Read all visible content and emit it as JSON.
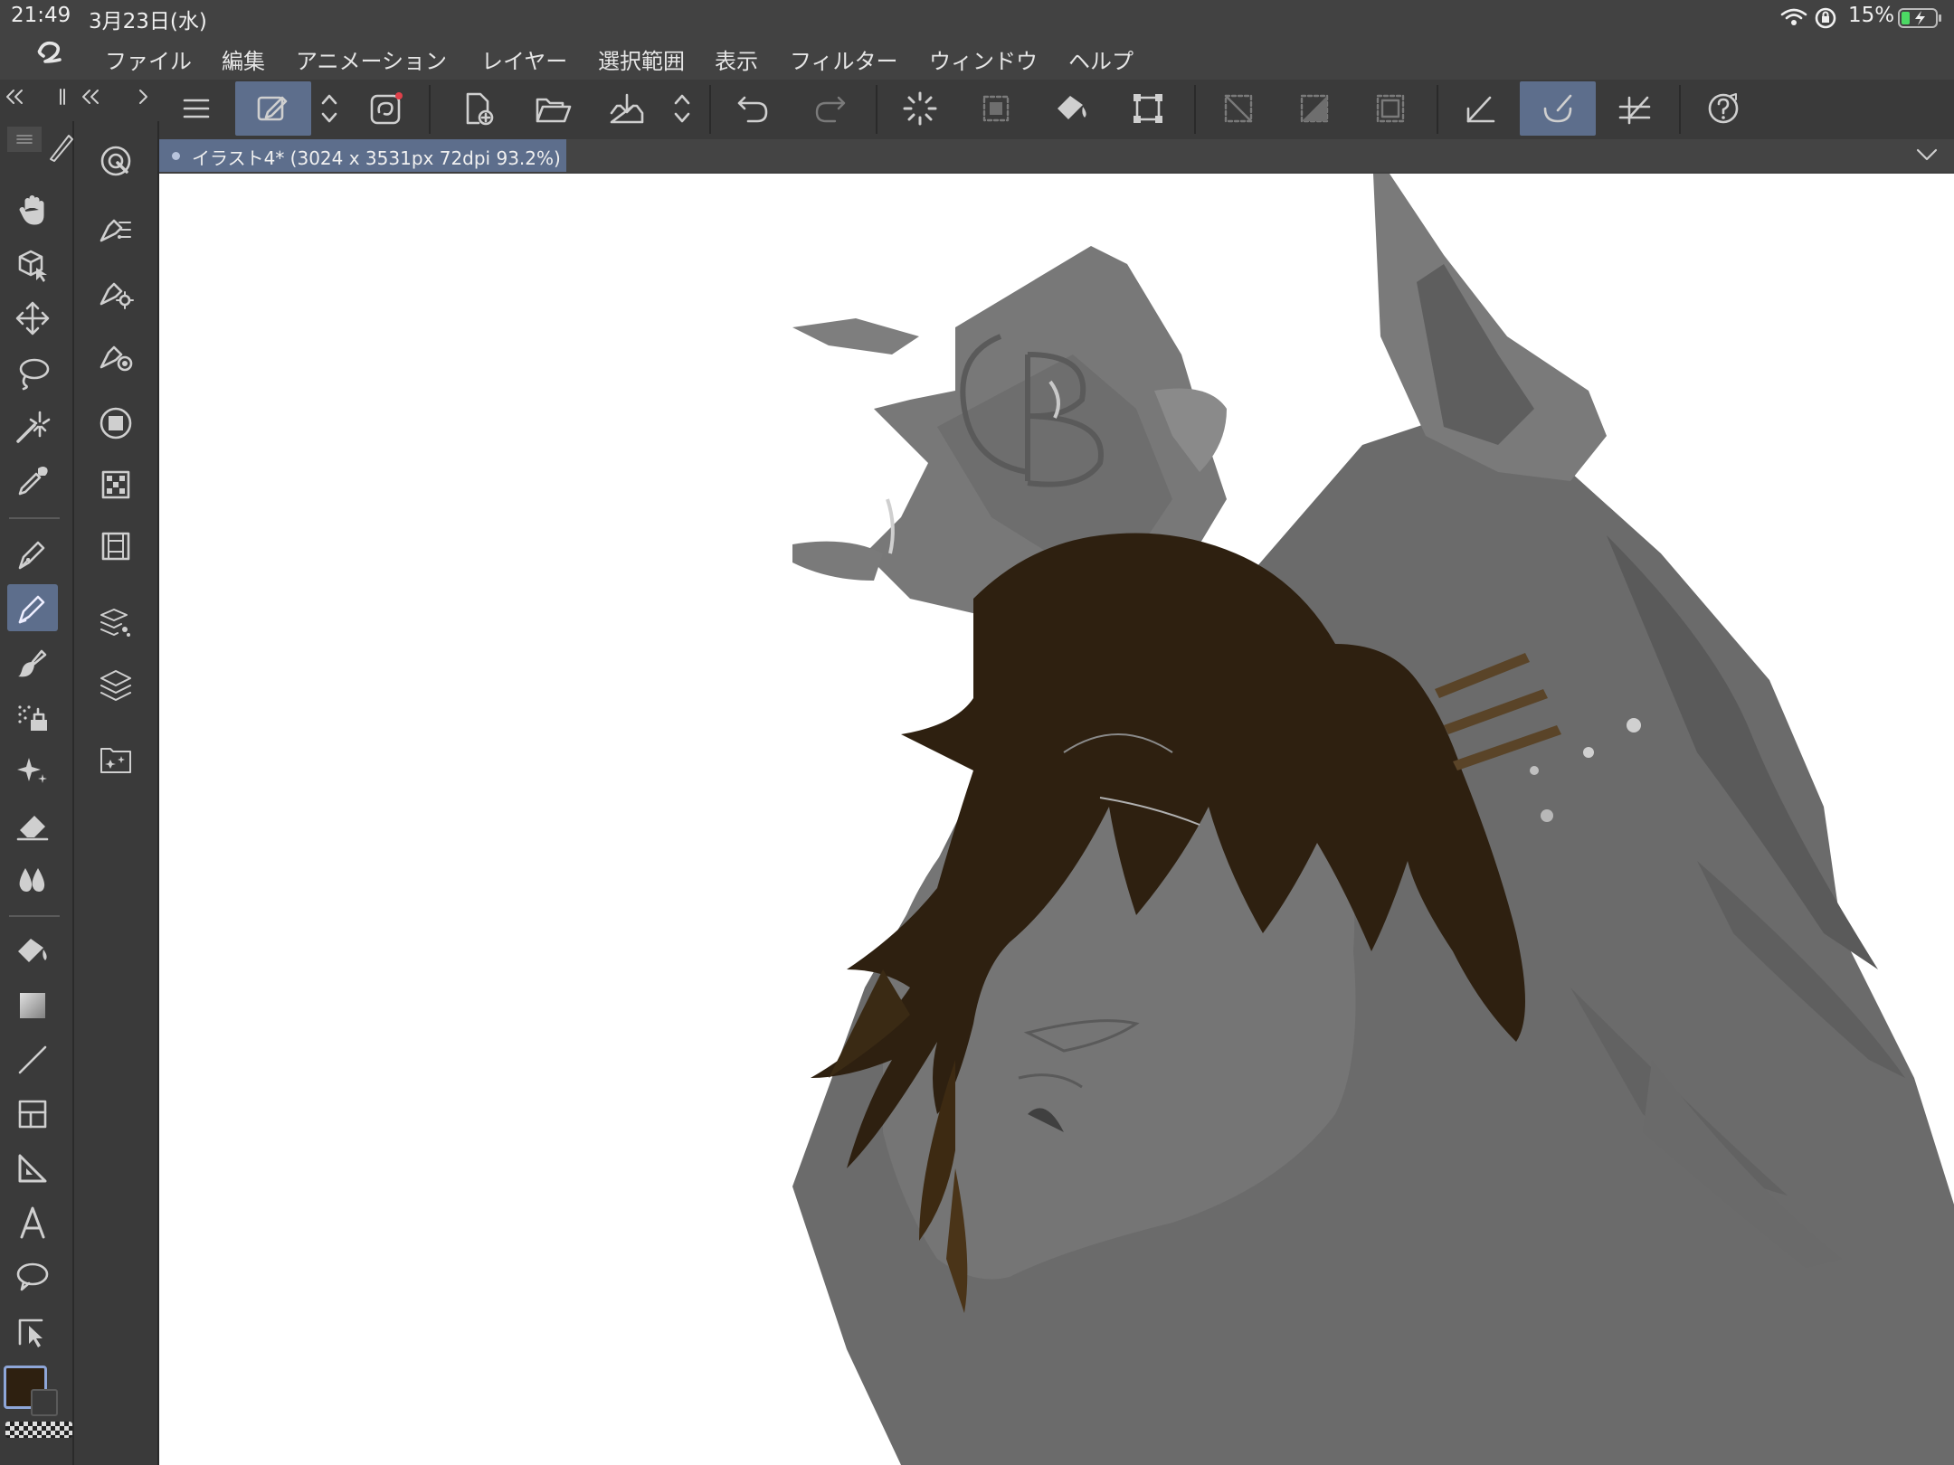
{
  "status": {
    "time": "21:49",
    "date": "3月23日(水)",
    "battery": "15%"
  },
  "menu": {
    "items": [
      "ファイル",
      "編集",
      "アニメーション",
      "レイヤー",
      "選択範囲",
      "表示",
      "フィルター",
      "ウィンドウ",
      "ヘルプ"
    ]
  },
  "document": {
    "tab_label": "イラスト4* (3024 x 3531px 72dpi 93.2%)"
  },
  "colors": {
    "main_color": "#2e2010",
    "sub_color": "#3a3a3a",
    "accent": "#5d6e8c"
  },
  "toolbar": {
    "icons": [
      "menu-icon",
      "brush-size-toggle-icon",
      "stabilizer-icon",
      "new-file-icon",
      "open-file-icon",
      "save-icon",
      "undo-icon",
      "redo-icon",
      "loading-spinner-icon",
      "select-all-icon",
      "fill-icon",
      "transform-icon",
      "clear-selection-icon",
      "invert-selection-icon",
      "show-selection-area-icon",
      "snap-to-ruler-icon",
      "snap-to-special-ruler-icon",
      "snap-to-grid-icon",
      "help-icon"
    ]
  },
  "tools": {
    "selected": "pen",
    "icons": [
      "hand-icon",
      "3d-move-icon",
      "move-icon",
      "lasso-select-icon",
      "magic-wand-icon",
      "eyedropper-icon",
      "pen-icon",
      "pencil-icon",
      "brush-icon",
      "airbrush-icon",
      "decoration-icon",
      "eraser-icon",
      "blend-icon",
      "fill-icon",
      "gradient-icon",
      "line-icon",
      "frame-icon",
      "ruler-icon",
      "text-icon",
      "speech-balloon-icon",
      "correct-line-icon"
    ]
  }
}
